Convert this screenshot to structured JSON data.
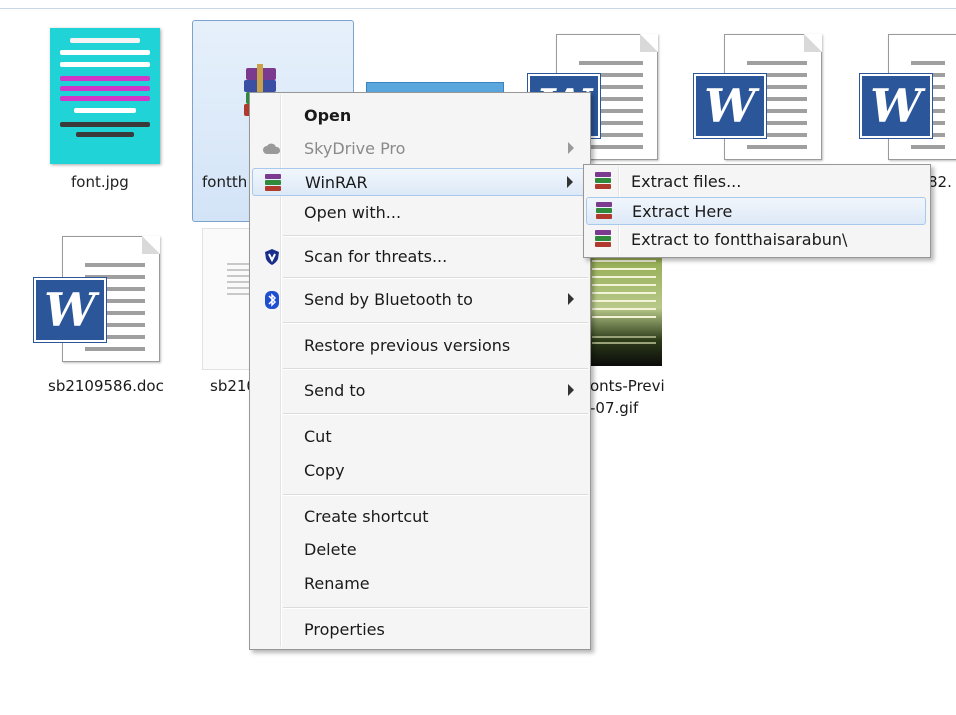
{
  "files": [
    {
      "name": "font.jpg",
      "type": "jpg"
    },
    {
      "name": "fontth",
      "type": "rar",
      "selected": true
    },
    {
      "name": "",
      "type": "image"
    },
    {
      "name": "",
      "type": "doc"
    },
    {
      "name": "",
      "type": "doc"
    },
    {
      "name": "82.",
      "type": "doc"
    },
    {
      "name": "sb2109586.doc",
      "type": "doc"
    },
    {
      "name": "sb210",
      "type": "doc"
    },
    {
      "name": "onts-Previ",
      "name_line2": "-07.gif",
      "type": "gif"
    }
  ],
  "context_menu": {
    "items": [
      {
        "label": "Open",
        "bold": true
      },
      {
        "label": "SkyDrive Pro",
        "disabled": true,
        "submenu": true,
        "icon": "cloud-icon"
      },
      {
        "label": "WinRAR",
        "submenu": true,
        "highlighted": true,
        "icon": "winrar-icon"
      },
      {
        "label": "Open with..."
      },
      {
        "label": "Scan for threats...",
        "icon": "shield-icon"
      },
      {
        "label": "Send by Bluetooth to",
        "submenu": true,
        "icon": "bluetooth-icon"
      },
      {
        "label": "Restore previous versions"
      },
      {
        "label": "Send to",
        "submenu": true
      },
      {
        "label": "Cut"
      },
      {
        "label": "Copy"
      },
      {
        "label": "Create shortcut"
      },
      {
        "label": "Delete"
      },
      {
        "label": "Rename"
      },
      {
        "label": "Properties"
      }
    ]
  },
  "winrar_submenu": {
    "items": [
      {
        "label": "Extract files...",
        "icon": "winrar-icon"
      },
      {
        "label": "Extract Here",
        "icon": "winrar-icon",
        "highlighted": true
      },
      {
        "label": "Extract to fontthaisarabun\\",
        "icon": "winrar-icon"
      }
    ]
  },
  "colors": {
    "selection": "#d3e4f7",
    "word_blue": "#2b579a",
    "menu_bg": "#f5f5f5",
    "highlight_border": "#a8c8ec"
  }
}
